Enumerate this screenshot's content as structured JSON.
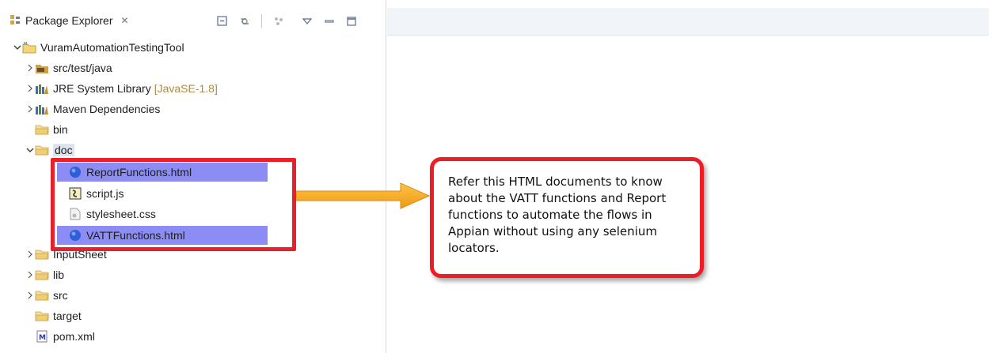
{
  "panel": {
    "title": "Package Explorer",
    "close_glyph": "✕"
  },
  "toolbar": {
    "icons": [
      "collapse-all-icon",
      "link-with-editor-icon",
      "focus-icon",
      "view-menu-icon",
      "minimize-icon",
      "maximize-icon"
    ]
  },
  "tree": {
    "items": [
      {
        "label": "VuramAutomationTestingTool",
        "decoration": "",
        "icon": "project-icon",
        "expanded": true
      },
      {
        "label": "src/test/java",
        "decoration": "",
        "icon": "source-folder-icon",
        "expanded": false
      },
      {
        "label": "JRE System Library",
        "decoration": "[JavaSE-1.8]",
        "icon": "library-icon",
        "expanded": false
      },
      {
        "label": "Maven Dependencies",
        "decoration": "",
        "icon": "library-icon",
        "expanded": false
      },
      {
        "label": "bin",
        "decoration": "",
        "icon": "folder-icon",
        "expanded": null
      },
      {
        "label": "doc",
        "decoration": "",
        "icon": "folder-icon",
        "expanded": true
      },
      {
        "label": "ReportFunctions.html",
        "decoration": "",
        "icon": "html-file-icon",
        "selected": true
      },
      {
        "label": "script.js",
        "decoration": "",
        "icon": "js-file-icon",
        "selected": false
      },
      {
        "label": "stylesheet.css",
        "decoration": "",
        "icon": "css-file-icon",
        "selected": false
      },
      {
        "label": "VATTFunctions.html",
        "decoration": "",
        "icon": "html-file-icon",
        "selected": true
      },
      {
        "label": "InputSheet",
        "decoration": "",
        "icon": "folder-icon",
        "expanded": false
      },
      {
        "label": "lib",
        "decoration": "",
        "icon": "folder-icon",
        "expanded": false
      },
      {
        "label": "src",
        "decoration": "",
        "icon": "folder-icon",
        "expanded": false
      },
      {
        "label": "target",
        "decoration": "",
        "icon": "folder-icon",
        "expanded": null
      },
      {
        "label": "pom.xml",
        "decoration": "",
        "icon": "maven-file-icon",
        "expanded": null
      }
    ]
  },
  "callout": {
    "text": "Refer this HTML documents to know about the VATT functions and Report functions to automate the flows in Appian without using any selenium locators."
  },
  "colors": {
    "selection": "#8c8cf5",
    "annotation_red": "#e8202a",
    "arrow_orange": "#f5a623",
    "decoration": "#b08a3e"
  }
}
